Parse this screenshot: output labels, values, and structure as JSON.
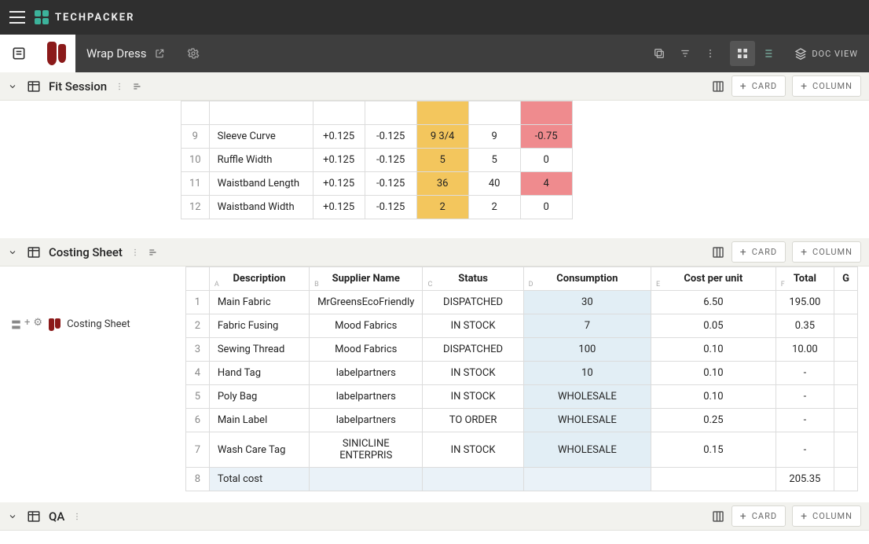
{
  "brand": "TECHPACKER",
  "project_title": "Wrap Dress",
  "docview_label": "DOC VIEW",
  "buttons": {
    "card": "CARD",
    "column": "COLUMN"
  },
  "sections": {
    "fit": {
      "name": "Fit Session"
    },
    "costing": {
      "name": "Costing Sheet"
    },
    "qa": {
      "name": "QA"
    }
  },
  "side_chip_label": "Costing Sheet",
  "fit_rows": [
    {
      "n": "9",
      "desc": "Sleeve Curve",
      "tolp": "+0.125",
      "tolm": "-0.125",
      "spec": "9 3/4",
      "msr": "9",
      "diff": "-0.75",
      "diff_hl": "red"
    },
    {
      "n": "10",
      "desc": "Ruffle Width",
      "tolp": "+0.125",
      "tolm": "-0.125",
      "spec": "5",
      "msr": "5",
      "diff": "0",
      "diff_hl": ""
    },
    {
      "n": "11",
      "desc": "Waistband Length",
      "tolp": "+0.125",
      "tolm": "-0.125",
      "spec": "36",
      "msr": "40",
      "diff": "4",
      "diff_hl": "red"
    },
    {
      "n": "12",
      "desc": "Waistband Width",
      "tolp": "+0.125",
      "tolm": "-0.125",
      "spec": "2",
      "msr": "2",
      "diff": "0",
      "diff_hl": ""
    }
  ],
  "cost_headers": {
    "desc": "Description",
    "sup": "Supplier Name",
    "stat": "Status",
    "cons": "Consumption",
    "cost": "Cost per unit",
    "total": "Total",
    "g": "G"
  },
  "col_keys": {
    "desc": "A",
    "sup": "B",
    "stat": "C",
    "cons": "D",
    "cost": "E",
    "total": "F"
  },
  "cost_rows": [
    {
      "n": "1",
      "desc": "Main Fabric",
      "sup": "MrGreensEcoFriendly",
      "stat": "DISPATCHED",
      "cons": "30",
      "cost": "6.50",
      "total": "195.00"
    },
    {
      "n": "2",
      "desc": "Fabric Fusing",
      "sup": "Mood Fabrics",
      "stat": "IN STOCK",
      "cons": "7",
      "cost": "0.05",
      "total": "0.35"
    },
    {
      "n": "3",
      "desc": "Sewing Thread",
      "sup": "Mood Fabrics",
      "stat": "DISPATCHED",
      "cons": "100",
      "cost": "0.10",
      "total": "10.00"
    },
    {
      "n": "4",
      "desc": "Hand Tag",
      "sup": "labelpartners",
      "stat": "IN STOCK",
      "cons": "10",
      "cost": "0.10",
      "total": "-"
    },
    {
      "n": "5",
      "desc": "Poly Bag",
      "sup": "labelpartners",
      "stat": "IN STOCK",
      "cons": "WHOLESALE",
      "cost": "0.10",
      "total": "-"
    },
    {
      "n": "6",
      "desc": "Main Label",
      "sup": "labelpartners",
      "stat": "TO ORDER",
      "cons": "WHOLESALE",
      "cost": "0.25",
      "total": "-"
    },
    {
      "n": "7",
      "desc": "Wash Care Tag",
      "sup": "SINICLINE ENTERPRIS",
      "stat": "IN STOCK",
      "cons": "WHOLESALE",
      "cost": "0.15",
      "total": "-"
    }
  ],
  "cost_total_row": {
    "n": "8",
    "desc": "Total cost",
    "total": "205.35"
  }
}
